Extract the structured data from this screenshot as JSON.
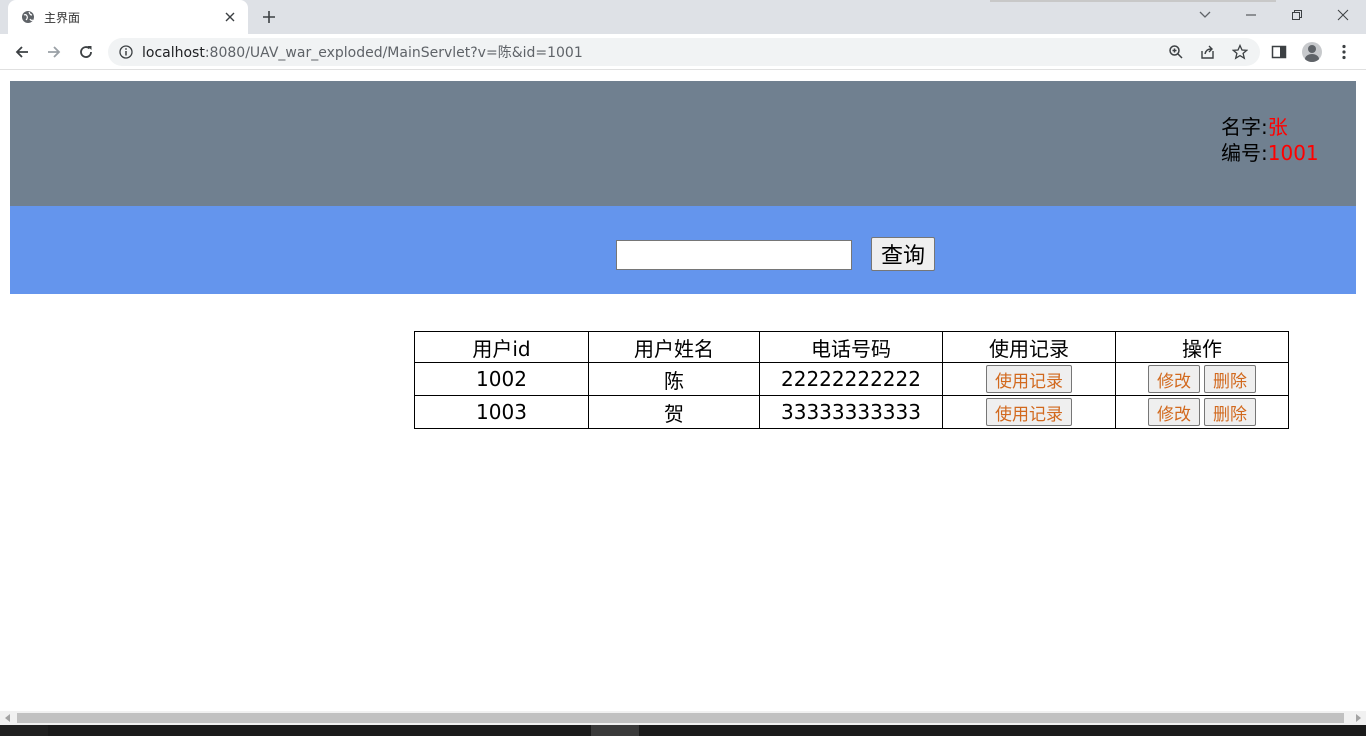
{
  "browser": {
    "tab_title": "主界面",
    "url_host": "localhost",
    "url_rest": ":8080/UAV_war_exploded/MainServlet?v=陈&id=1001"
  },
  "header": {
    "name_label": "名字:",
    "name_value": "张",
    "id_label": "编号:",
    "id_value": "1001"
  },
  "search": {
    "value": "",
    "button_label": "查询"
  },
  "table": {
    "headers": [
      "用户id",
      "用户姓名",
      "电话号码",
      "使用记录",
      "操作"
    ],
    "rows": [
      {
        "id": "1002",
        "name": "陈",
        "phone": "22222222222",
        "record_btn": "使用记录",
        "edit_btn": "修改",
        "delete_btn": "删除"
      },
      {
        "id": "1003",
        "name": "贺",
        "phone": "33333333333",
        "record_btn": "使用记录",
        "edit_btn": "修改",
        "delete_btn": "删除"
      }
    ]
  },
  "colors": {
    "header_band": "#708090",
    "search_band": "#6495ed",
    "value_highlight": "#ff0000",
    "action_text": "#d2691e"
  }
}
